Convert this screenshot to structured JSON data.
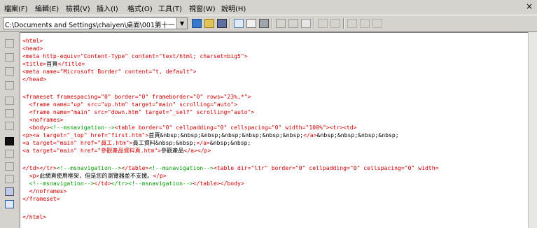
{
  "menubar": {
    "items": [
      "檔案(F)",
      "編輯(E)",
      "檢視(V)",
      "插入(I)",
      "格式(O)",
      "工具(T)",
      "視窗(W)",
      "說明(H)"
    ],
    "close_glyph": "×"
  },
  "toolbar": {
    "path_value": "C:\\Documents and Settings\\chaiyen\\桌面\\001第十一",
    "icons": [
      "open-folder-icon",
      "folder-icon",
      "save-icon",
      "preview-icon",
      "print-preview-icon",
      "print-icon",
      "cut-icon",
      "copy-icon",
      "paste-icon",
      "outdent-icon",
      "indent-icon",
      "insert-row-icon",
      "insert-col-icon",
      "table-icon"
    ]
  },
  "leftbar": {
    "icons": [
      "pointer-icon",
      "text-icon",
      "underline-icon",
      "image-icon",
      "pencil-icon",
      "eraser-icon",
      "hand-icon",
      "find-icon",
      "grid-icon",
      "check-icon",
      "brush-icon",
      "frame-icon",
      "selected-view-icon"
    ]
  },
  "editor": {
    "lines": [
      [
        [
          "tag",
          "<html>"
        ]
      ],
      [
        [
          "tag",
          "<head>"
        ]
      ],
      [
        [
          "tag",
          "<meta http-equiv=\"Content-Type\" content=\"text/html; charset=big5\">"
        ]
      ],
      [
        [
          "tag",
          "<title>"
        ],
        [
          "txt",
          "首頁"
        ],
        [
          "tag",
          "</title>"
        ]
      ],
      [
        [
          "tag",
          "<meta name=\"Microsoft Border\" content=\"t, default\">"
        ]
      ],
      [
        [
          "tag",
          "</head>"
        ]
      ],
      [
        [
          "txt",
          ""
        ]
      ],
      [
        [
          "tag",
          "<frameset framespacing=\"0\" border=\"0\" frameborder=\"0\" rows=\"23%,*\">"
        ]
      ],
      [
        [
          "tag",
          "  <frame name=\"up\" src=\"up.htm\" target=\"main\" scrolling=\"auto\">"
        ]
      ],
      [
        [
          "tag",
          "  <frame name=\"main\" src=\"down.htm\" target=\"_self\" scrolling=\"auto\">"
        ]
      ],
      [
        [
          "tag",
          "  <noframes>"
        ]
      ],
      [
        [
          "tag",
          "  <body>"
        ],
        [
          "cmt",
          "<!--msnavigation-->"
        ],
        [
          "tag",
          "<table border=\"0\" cellpadding=\"0\" cellspacing=\"0\" width=\"100%\"><tr><td>"
        ]
      ],
      [
        [
          "tag",
          "<p><a target=\"_top\" href=\"first.htm\">"
        ],
        [
          "txt",
          "首頁&nbsp;&nbsp;&nbsp;&nbsp;&nbsp;&nbsp;&nbsp;"
        ],
        [
          "tag",
          "</a>"
        ],
        [
          "txt",
          "&nbsp;&nbsp;&nbsp;&nbsp;"
        ]
      ],
      [
        [
          "tag",
          "<a target=\"main\" href=\"員工.htm\">"
        ],
        [
          "txt",
          "員工資料&nbsp;&nbsp;"
        ],
        [
          "tag",
          "</a>"
        ],
        [
          "txt",
          "&nbsp;&nbsp;"
        ]
      ],
      [
        [
          "tag",
          "<a target=\"main\" href=\"參觀產品資料頁.htm\">"
        ],
        [
          "txt",
          "參觀產品"
        ],
        [
          "tag",
          "</a></p>"
        ]
      ],
      [
        [
          "txt",
          ""
        ]
      ],
      [
        [
          "tag",
          "</td></tr>"
        ],
        [
          "cmt",
          "<!--msnavigation-->"
        ],
        [
          "tag",
          "</table>"
        ],
        [
          "cmt",
          "<!--msnavigation-->"
        ],
        [
          "tag",
          "<table dir=\"ltr\" border=\"0\" cellpadding=\"0\" cellspacing=\"0\" width="
        ]
      ],
      [
        [
          "tag",
          "  <p>"
        ],
        [
          "txt",
          "此網頁使用框架，但是您的瀏覽器並不支援。"
        ],
        [
          "tag",
          "</p>"
        ]
      ],
      [
        [
          "cmt",
          "  <!--msnavigation-->"
        ],
        [
          "tag",
          "</td>"
        ],
        [
          "cmt",
          "</tr><!--msnavigation-->"
        ],
        [
          "tag",
          "</table></body>"
        ]
      ],
      [
        [
          "tag",
          "  </noframes>"
        ]
      ],
      [
        [
          "tag",
          "</frameset>"
        ]
      ],
      [
        [
          "txt",
          ""
        ]
      ],
      [
        [
          "tag",
          "</html>"
        ]
      ]
    ]
  }
}
